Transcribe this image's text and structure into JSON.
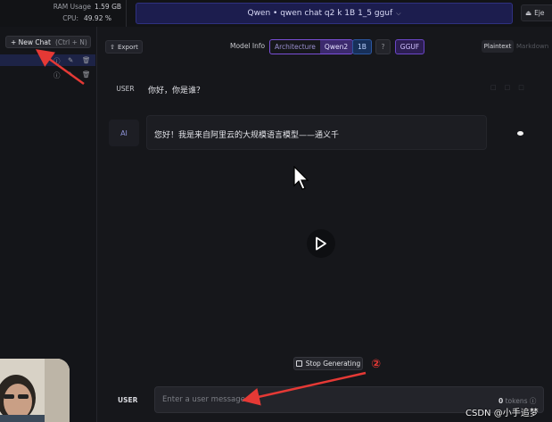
{
  "topbar": {
    "ram_label": "RAM Usage",
    "ram_value": "1.59 GB",
    "cpu_label": "CPU:",
    "cpu_value": "49.92 %",
    "model_selector": "Qwen • qwen chat q2 k 1B 1_5 gguf",
    "eject_label": "Eje"
  },
  "sidebar": {
    "new_chat_label": "+ New Chat",
    "new_chat_shortcut": "(Ctrl + N)"
  },
  "header": {
    "export_label": "Export",
    "model_info_label": "Model Info",
    "architecture_key": "Architecture",
    "architecture_value": "Qwen2",
    "size_chip": "1B",
    "help_chip": "?",
    "format_chip": "GGUF",
    "plaintext_tab": "Plaintext",
    "markdown_tab": "Markdown"
  },
  "messages": [
    {
      "role": "USER",
      "text": "你好，你是谁？"
    },
    {
      "role": "AI",
      "text": "您好！我是来自阿里云的大规模语言模型——通义千"
    }
  ],
  "composer": {
    "stop_label": "Stop Generating",
    "role_label": "USER",
    "placeholder": "Enter a user message...",
    "token_count": "0",
    "token_unit": "tokens"
  },
  "annotation": {
    "number": "②"
  },
  "watermark": "CSDN @小手追梦",
  "colors": {
    "accent_red": "#e53935",
    "selector_bg": "#1c1d4e"
  }
}
